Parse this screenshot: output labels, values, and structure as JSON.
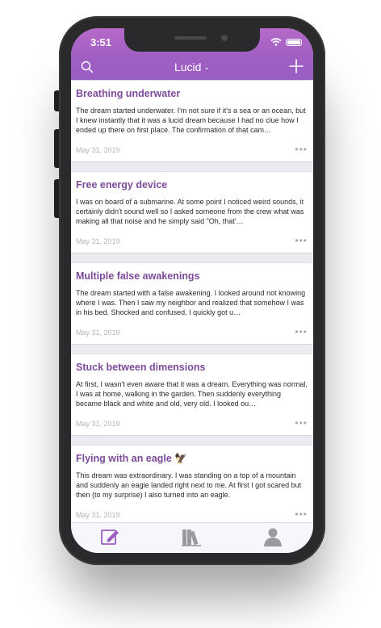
{
  "status_bar": {
    "time": "3:51"
  },
  "nav": {
    "title": "Lucid"
  },
  "colors": {
    "accent": "#9a5dc4",
    "card_title": "#7d4b9a",
    "tab_active": "#9a5dc4",
    "tab_inactive": "#9a9aa0"
  },
  "dreams": [
    {
      "title": "Breathing underwater",
      "excerpt": "The dream started underwater. I'm not sure if it's a sea or an ocean, but I knew instantly that it was a lucid dream because I had no clue how I ended up there on first place. The confirmation of that cam…",
      "date": "May 31, 2019"
    },
    {
      "title": "Free energy device",
      "excerpt": "I was on board of a submarine. At some point I noticed weird sounds, it certainly didn't sound well so I asked someone from the crew what was making all that noise and he simply said \"Oh, that'…",
      "date": "May 31, 2019"
    },
    {
      "title": "Multiple false awakenings",
      "excerpt": "The dream started with a false awakening. I looked around not knowing where I was. Then I saw my neighbor and realized that somehow I was in his bed. Shocked and confused, I quickly got u…",
      "date": "May 31, 2019"
    },
    {
      "title": "Stuck between dimensions",
      "excerpt": "At first, I wasn't even aware that it was a dream. Everything was normal, I was at home, walking in the garden. Then suddenly everything became black and white and old, very old. I looked ou…",
      "date": "May 31, 2019"
    },
    {
      "title": "Flying with an eagle 🦅",
      "excerpt": "This dream was extraordinary. I was standing on a top of a mountain and suddenly an eagle landed right next to me. At first I got scared but then (to my surprise) I also turned into an eagle.",
      "date": "May 31, 2019"
    }
  ],
  "more_glyph": "•••",
  "tabs": [
    {
      "icon": "pencil-square-icon",
      "active": true
    },
    {
      "icon": "books-icon",
      "active": false
    },
    {
      "icon": "person-icon",
      "active": false
    }
  ]
}
